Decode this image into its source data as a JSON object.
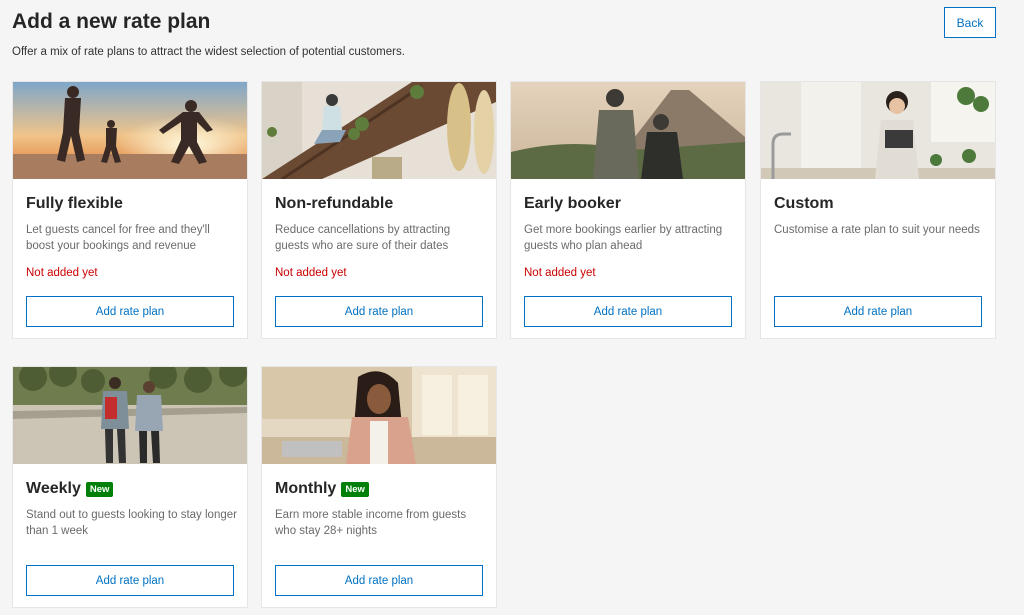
{
  "header": {
    "title": "Add a new rate plan",
    "subtitle": "Offer a mix of rate plans to attract the widest selection of potential customers.",
    "back_label": "Back"
  },
  "cards": [
    {
      "title": "Fully flexible",
      "description": "Let guests cancel for free and they'll boost your bookings and revenue",
      "status": "Not added yet",
      "button_label": "Add rate plan",
      "image": "friends-running-beach-sunset-photo"
    },
    {
      "title": "Non-refundable",
      "description": "Reduce cancellations by attracting guests who are sure of their dates",
      "status": "Not added yet",
      "button_label": "Add rate plan",
      "image": "woman-on-staircase-surfboards-photo"
    },
    {
      "title": "Early booker",
      "description": "Get more bookings earlier by attracting guests who plan ahead",
      "status": "Not added yet",
      "button_label": "Add rate plan",
      "image": "couple-hiking-mountain-photo"
    },
    {
      "title": "Custom",
      "description": "Customise a rate plan to suit your needs",
      "status": "",
      "button_label": "Add rate plan",
      "image": "woman-with-tablet-kitchen-photo"
    },
    {
      "title": "Weekly",
      "badge": "New",
      "description": "Stand out to guests looking to stay longer than 1 week",
      "status": "",
      "button_label": "Add rate plan",
      "image": "couple-walking-park-photo"
    },
    {
      "title": "Monthly",
      "badge": "New",
      "description": "Earn more stable income from guests who stay 28+ nights",
      "status": "",
      "button_label": "Add rate plan",
      "image": "woman-working-laptop-home-photo"
    }
  ],
  "colors": {
    "accent": "#0071c2",
    "status_red": "#cc0000",
    "badge_green": "#008009",
    "background": "#f5f5f5"
  }
}
